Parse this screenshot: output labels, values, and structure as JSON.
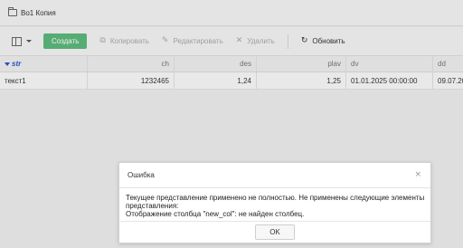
{
  "window": {
    "title": "Во1 Копия",
    "icon": "folder-icon"
  },
  "toolbar": {
    "layout_icon": "layout-icon",
    "create_label": "Создать",
    "create_color": "#5cb87b",
    "copy_label": "Копировать",
    "edit_label": "Редактировать",
    "delete_label": "Удалить",
    "refresh_label": "Обновить"
  },
  "grid": {
    "columns": [
      "str",
      "ch",
      "des",
      "plav",
      "dv",
      "dd"
    ],
    "rows": [
      [
        "текст1",
        "1232465",
        "1,24",
        "1,25",
        "01.01.2025 00:00:00",
        "09.07.20"
      ]
    ]
  },
  "dialog": {
    "title": "Ошибка",
    "message_line1": "Текущее представление применено не полностью. Не применены следующие элементы",
    "message_line2": "представления:",
    "message_line3": "Отображение столбца \"new_col\": не найден столбец.",
    "ok_label": "OK"
  }
}
